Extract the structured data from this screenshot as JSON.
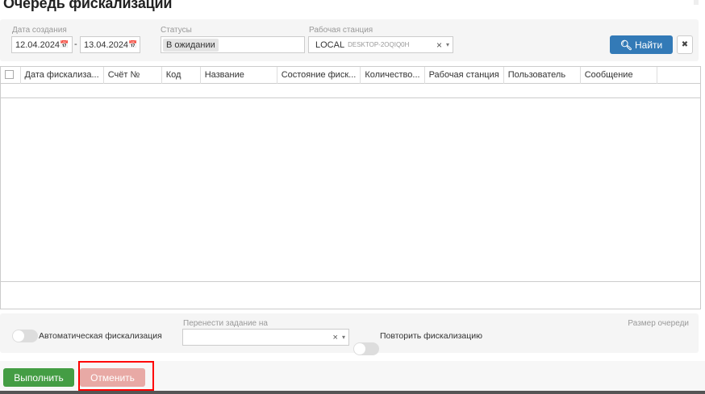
{
  "title": "Очередь фискализации",
  "filters": {
    "date_label": "Дата создания",
    "date_from": "12.04.2024",
    "date_sep": "-",
    "date_to": "13.04.2024",
    "status_label": "Статусы",
    "status_tag": "В ожидании",
    "station_label": "Рабочая станция",
    "station_value": "LOCAL",
    "station_sub": "DESKTOP-2OQIQ0H",
    "clear": "×",
    "caret": "▾",
    "find": "Найти",
    "reset": "✖"
  },
  "table": {
    "columns": [
      "Дата фискализа...",
      "Счёт №",
      "Код",
      "Название",
      "Состояние фиск...",
      "Количество...",
      "Рабочая станция",
      "Пользователь",
      "Сообщение",
      ""
    ]
  },
  "bottom": {
    "auto_label": "Автоматическая фискализация",
    "move_label": "Перенести задание на",
    "clear": "×",
    "caret": "▾",
    "repeat_label": "Повторить фискализацию",
    "queue_size_label": "Размер очереди"
  },
  "footer": {
    "execute": "Выполнить",
    "cancel": "Отменить"
  },
  "colors": {
    "primary": "#337ab7",
    "success": "#449d44",
    "danger_disabled": "#e8a9a5",
    "highlight": "#ff0000"
  }
}
